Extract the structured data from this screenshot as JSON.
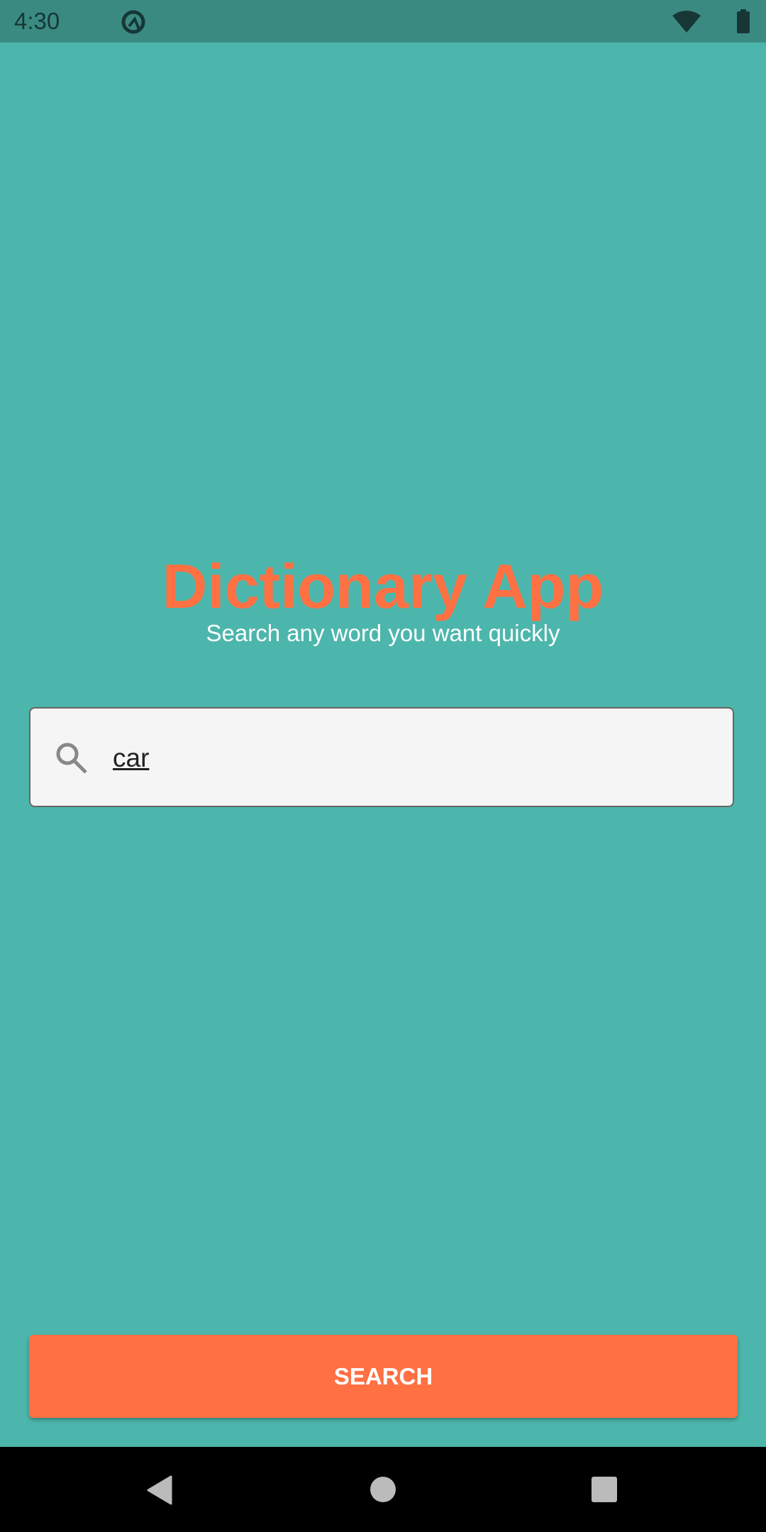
{
  "status_bar": {
    "time": "4:30",
    "icons": [
      "app-notification-icon",
      "wifi-icon",
      "battery-icon"
    ]
  },
  "header": {
    "title": "Dictionary App",
    "subtitle": "Search any word you want quickly"
  },
  "search": {
    "value": "car",
    "icon": "search-icon"
  },
  "actions": {
    "search_label": "SEARCH"
  },
  "nav_bar": {
    "icons": [
      "back-icon",
      "home-icon",
      "recents-icon"
    ]
  },
  "colors": {
    "background": "#4db6ac",
    "status_bar": "#3b8a82",
    "accent": "#ff7043",
    "input_bg": "#f5f5f5"
  }
}
